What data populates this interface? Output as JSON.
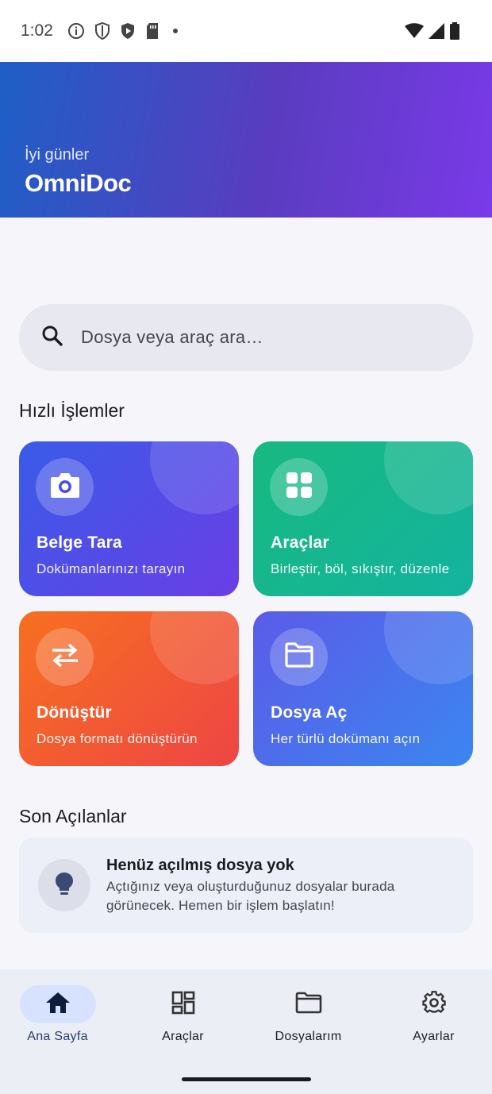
{
  "status_bar": {
    "time": "1:02",
    "icons": [
      "info-icon",
      "shield-icon",
      "play-protect-icon",
      "sd-card-icon",
      "dot-icon",
      "wifi-icon",
      "signal-icon",
      "battery-icon"
    ]
  },
  "header": {
    "greeting": "İyi günler",
    "title": "OmniDoc"
  },
  "search": {
    "placeholder": "Dosya veya araç ara…"
  },
  "quick_actions": {
    "title": "Hızlı İşlemler",
    "cards": [
      {
        "title": "Belge Tara",
        "subtitle": "Dokümanlarınızı tarayın",
        "icon": "camera-icon",
        "color": "#4a4de6"
      },
      {
        "title": "Araçlar",
        "subtitle": "Birleştir, böl, sıkıştır, düzenle",
        "icon": "grid-icon",
        "color": "#16b68e"
      },
      {
        "title": "Dönüştür",
        "subtitle": "Dosya formatı dönüştürün",
        "icon": "swap-icon",
        "color": "#f25a33"
      },
      {
        "title": "Dosya Aç",
        "subtitle": "Her türlü dokümanı açın",
        "icon": "folder-icon",
        "color": "#4b71ec"
      }
    ]
  },
  "recent": {
    "title": "Son Açılanlar",
    "empty_title": "Henüz açılmış dosya yok",
    "empty_desc": "Açtığınız veya oluşturduğunuz dosyalar burada görünecek. Hemen bir işlem başlatın!",
    "empty_icon": "lightbulb-icon"
  },
  "bottom_nav": {
    "items": [
      {
        "label": "Ana Sayfa",
        "icon": "home-icon",
        "active": true
      },
      {
        "label": "Araçlar",
        "icon": "dashboard-icon",
        "active": false
      },
      {
        "label": "Dosyalarım",
        "icon": "folder-icon",
        "active": false
      },
      {
        "label": "Ayarlar",
        "icon": "gear-icon",
        "active": false
      }
    ]
  }
}
